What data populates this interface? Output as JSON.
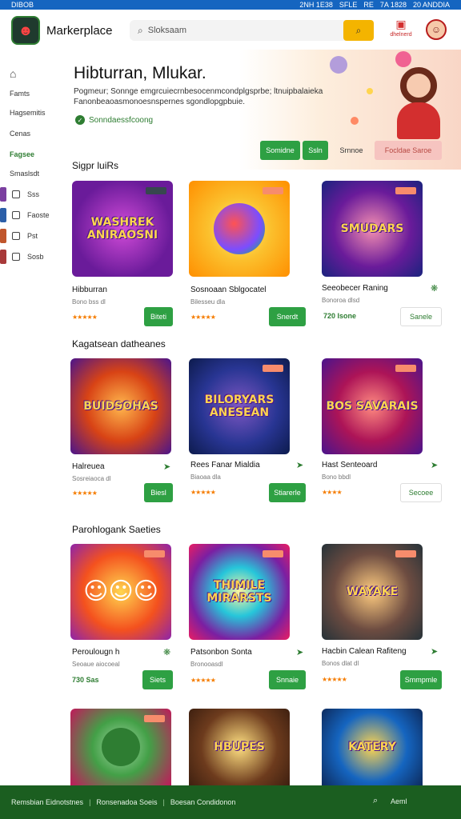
{
  "status_bar": {
    "left": "DIBOB",
    "right": [
      "2NH 1E38",
      "SFLE",
      "RE",
      "7A 1828",
      "20 ANDDIA"
    ]
  },
  "header": {
    "brand": "Markerplace",
    "search_placeholder": "Sloksaam",
    "cart_label": "dhelnerd"
  },
  "sidebar": {
    "items": [
      {
        "label": "Famts",
        "active": false
      },
      {
        "label": "Hagsemitis",
        "active": false
      },
      {
        "label": "Cenas",
        "active": false
      },
      {
        "label": "Fagsee",
        "active": true
      },
      {
        "label": "Smaslsdt",
        "active": false
      }
    ],
    "sub_items": [
      "Sss",
      "Faoste",
      "Pst",
      "Sosb"
    ]
  },
  "hero": {
    "title": "Hibturran, Mlukar.",
    "desc": "Pogmeur; Sonnge emgrcuiecrnbesocenmcondplgsprbe; ltnuipbalaieka Fanonbeaoasmonoesnspernes sgondlopgpbuie.",
    "check_text": "Sonndaessfcoong",
    "buttons": [
      "Somidne",
      "Ssln",
      "Srnnoe",
      "Focldae Saroe"
    ]
  },
  "sections": [
    {
      "title": "Sigpr luiRs",
      "cards": [
        {
          "img_text": "WASHREK ANIRAOSNI",
          "name": "Hibburran",
          "sub": "Bono bss dl",
          "stars": "★★★★★",
          "note": "",
          "tag": "",
          "button": "Biteti",
          "btn_style": "solid"
        },
        {
          "img_text": "",
          "name": "Sosnoaan Sblgocatel",
          "sub": "Bilesseu dla",
          "stars": "★★★★★",
          "note": "",
          "tag": "",
          "button": "Snerdt",
          "btn_style": "solid"
        },
        {
          "img_text": "SMUDARS",
          "name": "Seeobecer Raning",
          "sub": "Bonoroa dlsd",
          "stars": "",
          "note": "720 Isone",
          "tag": "❋",
          "button": "Sanele",
          "btn_style": "outline"
        }
      ]
    },
    {
      "title": "Kagatsean datheanes",
      "cards": [
        {
          "img_text": "BUIDSOHAS",
          "name": "Halreuea",
          "sub": "Sosreiaoca dl",
          "stars": "★★★★★",
          "note": "",
          "tag": "➤",
          "button": "Biesl",
          "btn_style": "solid"
        },
        {
          "img_text": "BILORYARS ANESEAN",
          "name": "Rees Fanar Mialdia",
          "sub": "Biaoaa dla",
          "stars": "★★★★★",
          "note": "",
          "tag": "➤",
          "button": "Stiarerle",
          "btn_style": "solid"
        },
        {
          "img_text": "BOS SAVARAIS",
          "name": "Hast Senteoard",
          "sub": "Bono bbdl",
          "stars": "★★★★",
          "note": "",
          "tag": "➤",
          "button": "Secoee",
          "btn_style": "outline"
        }
      ]
    },
    {
      "title": "Parohlogank Saeties",
      "cards": [
        {
          "img_text": "",
          "name": "Peroulougn h",
          "sub": "Seoaue aiocoeal",
          "stars": "",
          "note": "730 Sas",
          "tag": "❋",
          "button": "Siets",
          "btn_style": "solid"
        },
        {
          "img_text": "THIMILE MIRARSTS",
          "name": "Patsonbon Sonta",
          "sub": "Bronooasdl",
          "stars": "★★★★★",
          "note": "",
          "tag": "➤",
          "button": "Snnaie",
          "btn_style": "solid"
        },
        {
          "img_text": "WAYAKE",
          "name": "Hacbin Calean Rafiteng",
          "sub": "Bonos dlat dl",
          "stars": "★★★★★",
          "note": "",
          "tag": "➤",
          "button": "Smmpmle",
          "btn_style": "solid"
        }
      ]
    },
    {
      "title": "",
      "cards": [
        {
          "img_text": ""
        },
        {
          "img_text": "HBUPES"
        },
        {
          "img_text": "KATERY"
        }
      ]
    }
  ],
  "footer": {
    "items": [
      "Remsbian Eidnotstnes",
      "Ronsenadoa Soeis",
      "Boesan Condidonon"
    ],
    "search_label": "Aeml"
  }
}
